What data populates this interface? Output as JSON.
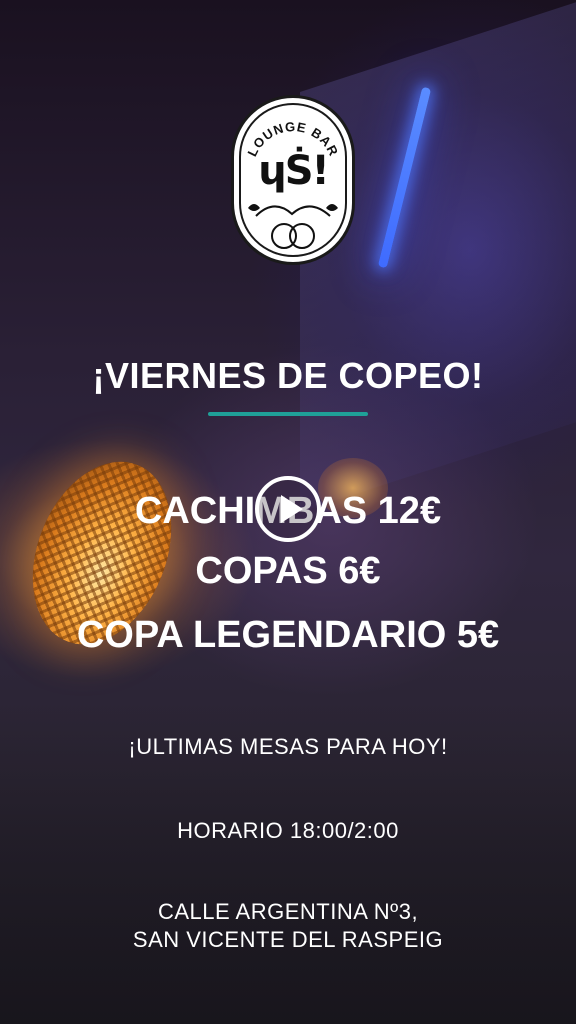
{
  "logo": {
    "arc_text": "LOUNGE BAR",
    "mark": "ɥṠ!"
  },
  "promo": {
    "headline": "¡VIERNES DE COPEO!",
    "lines": [
      "CACHIMBAS 12€",
      "COPAS 6€",
      "COPA LEGENDARIO 5€"
    ]
  },
  "notice": "¡ULTIMAS MESAS PARA HOY!",
  "hours": "HORARIO 18:00/2:00",
  "address": {
    "line1": "CALLE ARGENTINA Nº3,",
    "line2": "SAN VICENTE DEL RASPEIG"
  },
  "colors": {
    "accent": "#1fa098",
    "text": "#ffffff"
  },
  "icons": {
    "play": "play-icon"
  }
}
